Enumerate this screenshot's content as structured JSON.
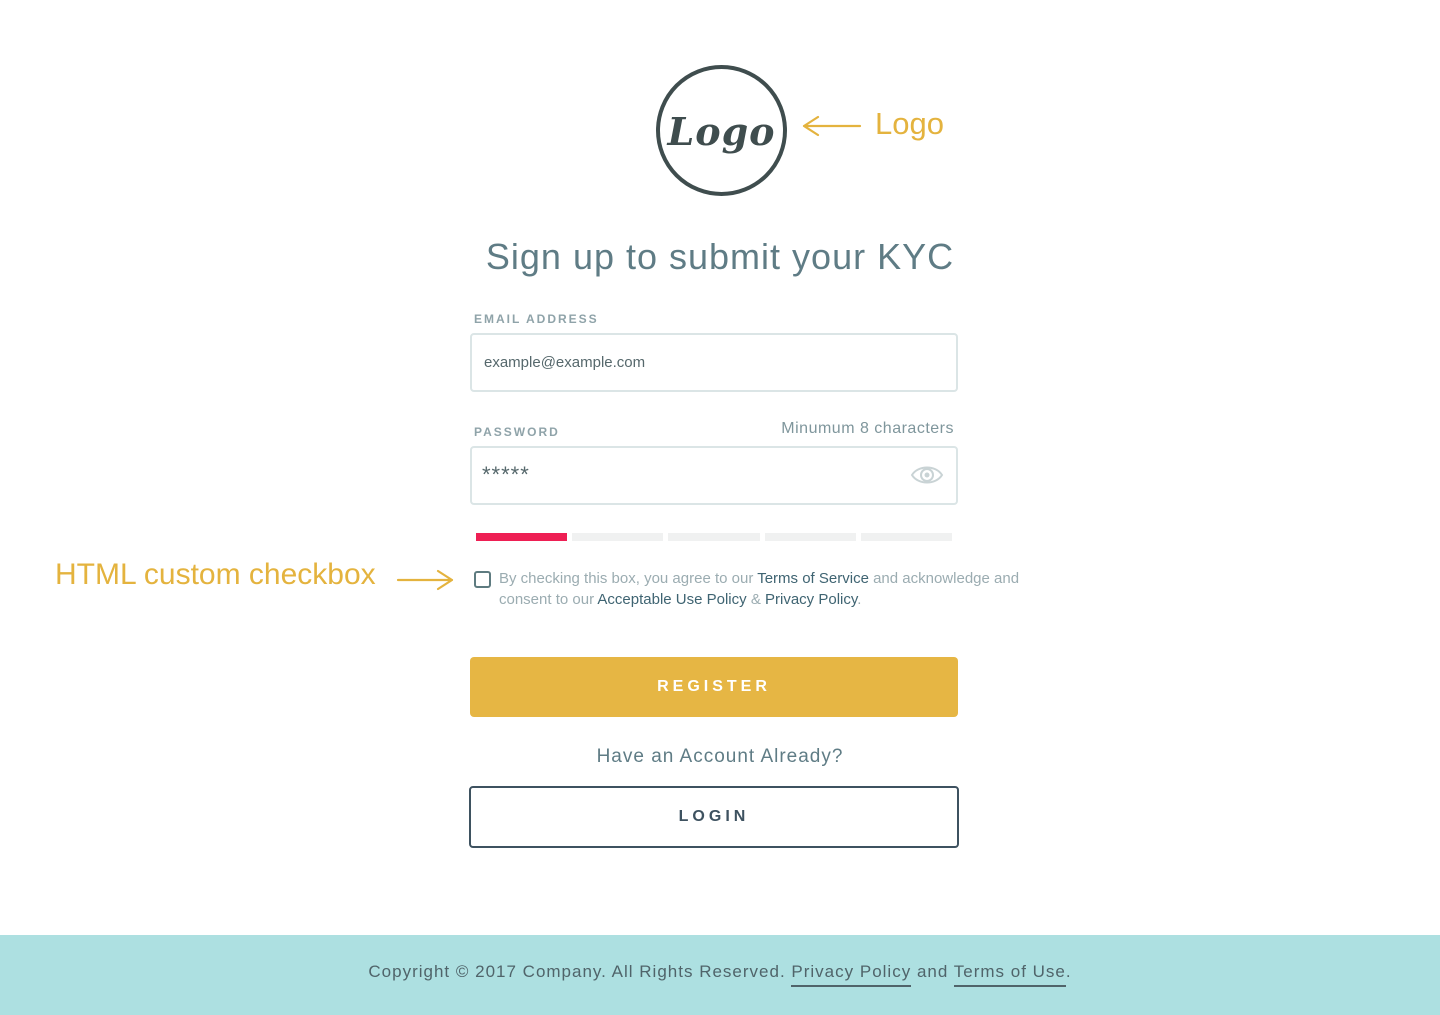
{
  "logo": {
    "text": "Logo"
  },
  "annotations": {
    "logo": "Logo",
    "checkbox": "HTML custom checkbox",
    "color": "#e4b33e"
  },
  "title": "Sign up to submit your KYC",
  "email": {
    "label": "EMAIL ADDRESS",
    "placeholder": "example@example.com"
  },
  "password": {
    "label": "PASSWORD",
    "hint": "Minumum 8 characters",
    "value_mask": "*****",
    "toggle_icon": "eye-icon"
  },
  "strength_meter": {
    "segments": 5,
    "filled": 1,
    "fill_color": "#ee1f54"
  },
  "terms": {
    "checked": false,
    "prefix": "By checking this box, you agree to our ",
    "terms_link": "Terms of Service",
    "middle": " and acknowledge and consent to our ",
    "aup_link": "Acceptable Use Policy",
    "amp": " & ",
    "privacy_link": "Privacy Policy",
    "suffix": "."
  },
  "register_label": "REGISTER",
  "have_account": "Have an Account Already?",
  "login_label": "LOGIN",
  "footer": {
    "copyright": "Copyright © 2017 Company. All Rights Reserved. ",
    "privacy_link": "Privacy Policy",
    "and": " and ",
    "terms_link": "Terms of Use",
    "end": "."
  },
  "colors": {
    "accent": "#e6b644",
    "footer_bg": "#ade0e1",
    "heading": "#5f7c85"
  }
}
